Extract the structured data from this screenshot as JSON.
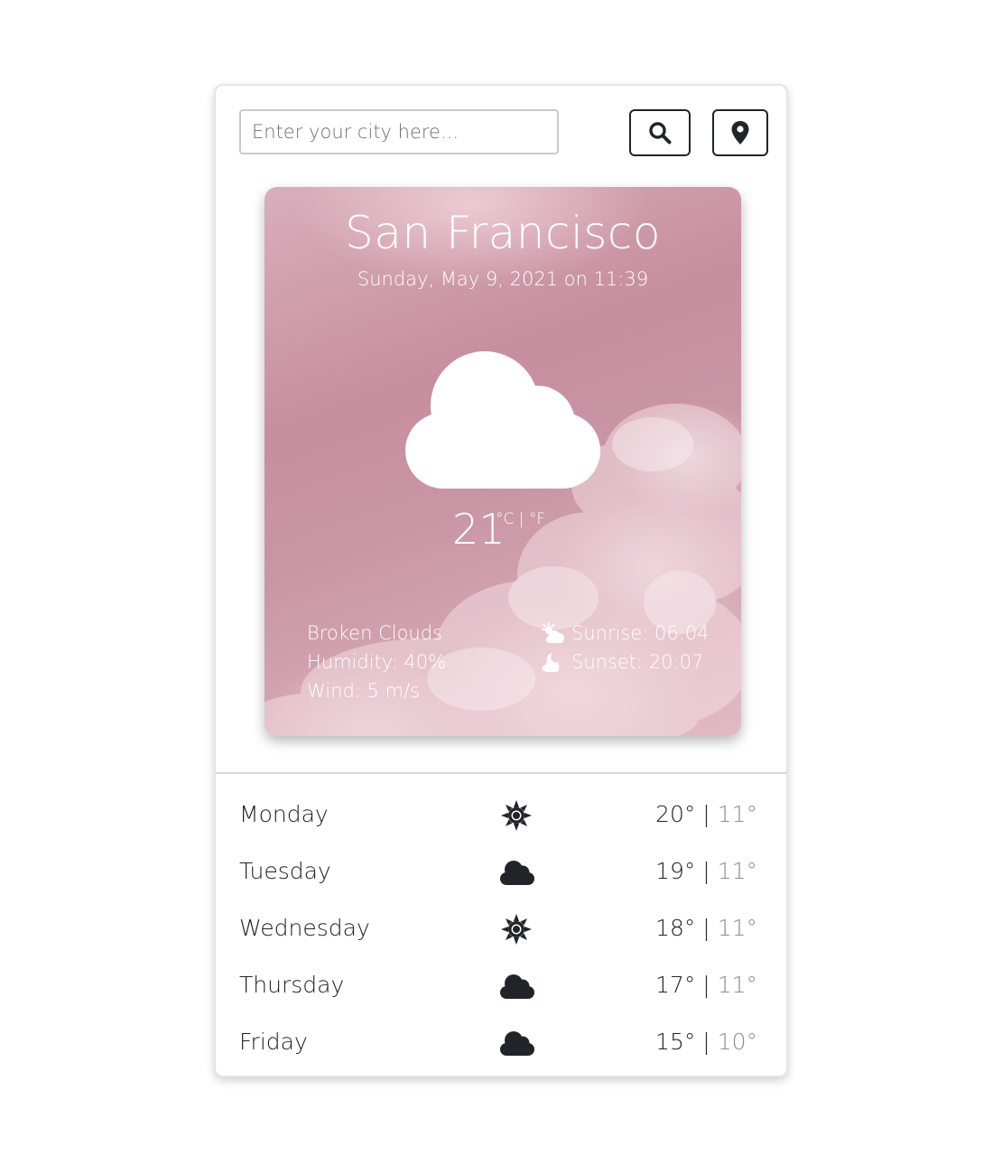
{
  "search": {
    "placeholder": "Enter your city here...",
    "value": ""
  },
  "buttons": {
    "search_icon": "search-icon",
    "location_icon": "map-marker-icon"
  },
  "current": {
    "city": "San Francisco",
    "datetime": "Sunday, May 9, 2021 on 11:39",
    "icon": "cloud-icon",
    "temperature": "21",
    "units": "°C | °F",
    "description": "Broken Clouds",
    "humidity": "Humidity: 40%",
    "wind": "Wind: 5 m/s",
    "sunrise": "Sunrise: 06:04",
    "sunset": "Sunset: 20:07"
  },
  "forecast": [
    {
      "day": "Monday",
      "icon": "sun-icon",
      "high": "20°",
      "low": "11°"
    },
    {
      "day": "Tuesday",
      "icon": "cloud-icon",
      "high": "19°",
      "low": "11°"
    },
    {
      "day": "Wednesday",
      "icon": "sun-icon",
      "high": "18°",
      "low": "11°"
    },
    {
      "day": "Thursday",
      "icon": "cloud-icon",
      "high": "17°",
      "low": "11°"
    },
    {
      "day": "Friday",
      "icon": "cloud-icon",
      "high": "15°",
      "low": "10°"
    }
  ],
  "colors": {
    "button_border": "#212529",
    "card_pink": "#c996a6",
    "text_dark": "#222222",
    "low_temp": "#8c8c8c"
  }
}
